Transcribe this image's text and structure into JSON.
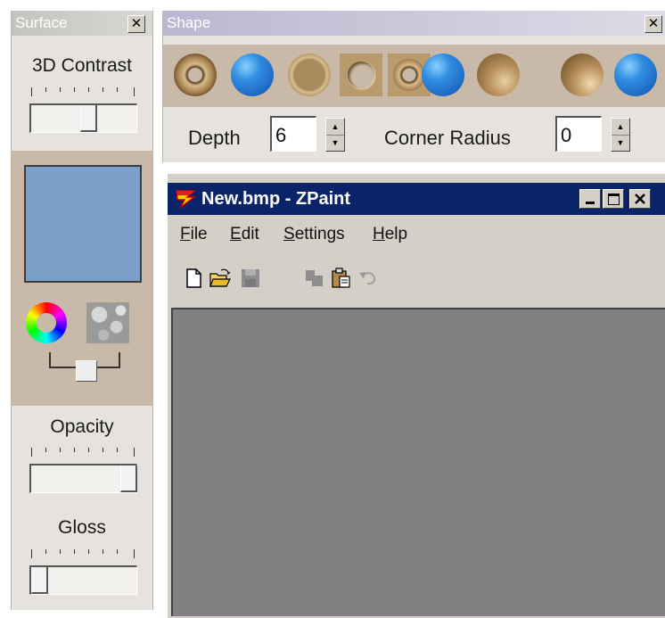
{
  "surface_panel": {
    "title": "Surface",
    "close_glyph": "✕",
    "contrast_label": "3D Contrast",
    "contrast_value": 0.55,
    "color_swatch": "#7aa0c9",
    "opacity_label": "Opacity",
    "opacity_value": 1.0,
    "gloss_label": "Gloss",
    "gloss_value": 0.0
  },
  "shape_panel": {
    "title": "Shape",
    "close_glyph": "✕",
    "shapes": [
      "donut-ring",
      "blue-ball",
      "cup-disc",
      "square-frame",
      "square-ring",
      "blue-ball",
      "bronze-ball",
      "sphere",
      "blue-ball"
    ],
    "depth_label": "Depth",
    "depth_value": "6",
    "corner_radius_label": "Corner Radius",
    "corner_radius_value": "0",
    "spin_up": "▲",
    "spin_down": "▼"
  },
  "zpaint": {
    "title": "New.bmp - ZPaint",
    "menu": {
      "file": {
        "key": "F",
        "rest": "ile"
      },
      "edit": {
        "key": "E",
        "rest": "dit"
      },
      "settings": {
        "key": "S",
        "rest": "ettings"
      },
      "help": {
        "key": "H",
        "rest": "elp"
      }
    },
    "toolbar_icons": [
      "new-file-icon",
      "open-folder-icon",
      "save-icon",
      "copy-icon",
      "paste-icon",
      "undo-icon"
    ]
  }
}
